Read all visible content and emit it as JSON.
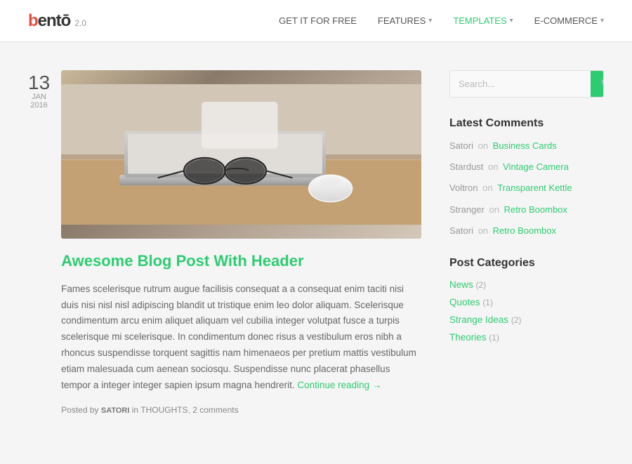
{
  "header": {
    "logo": "bentō",
    "logo_bento": "bentō",
    "version": "2.0",
    "nav": [
      {
        "label": "GET IT FOR FREE",
        "active": false,
        "hasArrow": false
      },
      {
        "label": "FEATURES",
        "active": false,
        "hasArrow": true
      },
      {
        "label": "TEMPLATES",
        "active": true,
        "hasArrow": true
      },
      {
        "label": "E-COMMERCE",
        "active": false,
        "hasArrow": true
      }
    ]
  },
  "article": {
    "date": {
      "day": "13",
      "month": "JAN",
      "year": "2016"
    },
    "title": "Awesome Blog Post With Header",
    "body": "Fames scelerisque rutrum augue facilisis consequat a a consequat enim taciti nisi duis nisi nisl nisl adipiscing blandit ut tristique enim leo dolor aliquam. Scelerisque condimentum arcu enim aliquet aliquam vel cubilia integer volutpat fusce a turpis scelerisque mi scelerisque. In condimentum donec risus a vestibulum eros nibh a rhoncus suspendisse torquent sagittis nam himenaeos per pretium mattis vestibulum etiam malesuada cum aenean sociosqu. Suspendisse nunc placerat phasellus tempor a integer integer sapien ipsum magna hendrerit.",
    "read_more": "Continue reading →",
    "footer": {
      "prefix": "Posted by",
      "author": "SATORI",
      "in_label": "in",
      "category": "THOUGHTS",
      "comments": "2 comments"
    }
  },
  "sidebar": {
    "search_placeholder": "Search...",
    "latest_comments_title": "Latest Comments",
    "comments": [
      {
        "author": "Satori",
        "on": "on",
        "link": "Business Cards"
      },
      {
        "author": "Stardust",
        "on": "on",
        "link": "Vintage Camera"
      },
      {
        "author": "Voltron",
        "on": "on",
        "link": "Transparent Kettle"
      },
      {
        "author": "Stranger",
        "on": "on",
        "link": "Retro Boombox"
      },
      {
        "author": "Satori",
        "on": "on",
        "link": "Retro Boombox"
      }
    ],
    "post_categories_title": "Post Categories",
    "categories": [
      {
        "label": "News",
        "count": "(2)"
      },
      {
        "label": "Quotes",
        "count": "(1)"
      },
      {
        "label": "Strange Ideas",
        "count": "(2)"
      },
      {
        "label": "Theories",
        "count": "(1)"
      }
    ]
  },
  "colors": {
    "accent": "#2ecc71",
    "logo_red": "#e74c3c"
  }
}
